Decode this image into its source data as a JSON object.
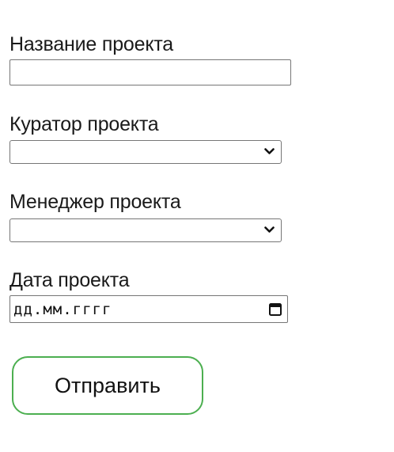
{
  "form": {
    "project_name": {
      "label": "Название проекта",
      "value": ""
    },
    "curator": {
      "label": "Куратор проекта",
      "selected": ""
    },
    "manager": {
      "label": "Менеджер проекта",
      "selected": ""
    },
    "date": {
      "label": "Дата проекта",
      "placeholder": "дд.мм.гггг"
    },
    "submit_label": "Отправить"
  },
  "colors": {
    "button_border": "#4caf50",
    "input_border": "#767676"
  },
  "icons": {
    "select_arrow": "chevron-down-icon",
    "date_picker": "calendar-icon"
  }
}
